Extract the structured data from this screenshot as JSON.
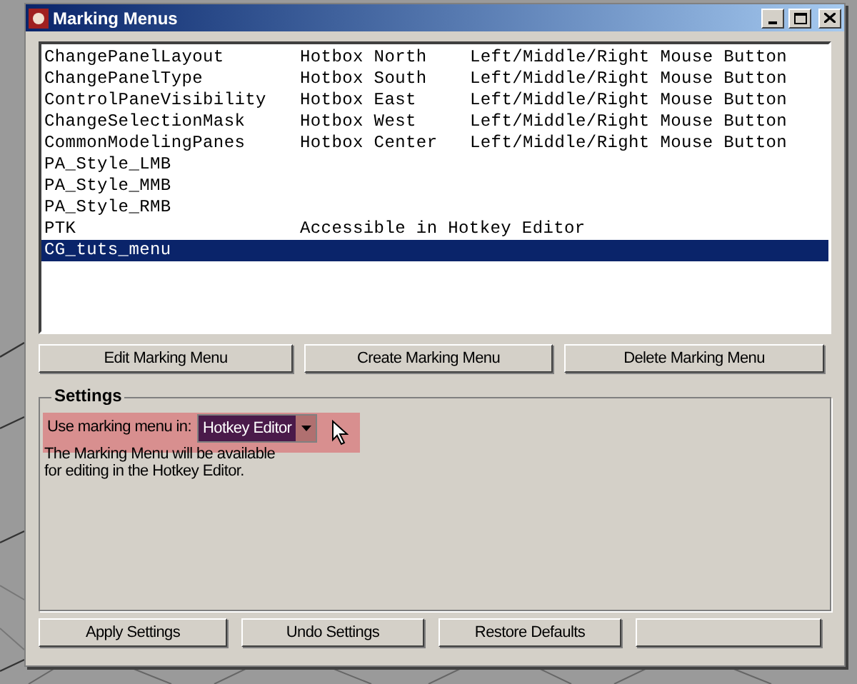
{
  "window": {
    "title": "Marking Menus"
  },
  "menus": [
    {
      "name": "ChangePanelLayout",
      "location": "Hotbox North",
      "trigger": "Left/Middle/Right Mouse Button",
      "selected": false
    },
    {
      "name": "ChangePanelType",
      "location": "Hotbox South",
      "trigger": "Left/Middle/Right Mouse Button",
      "selected": false
    },
    {
      "name": "ControlPaneVisibility",
      "location": "Hotbox East",
      "trigger": "Left/Middle/Right Mouse Button",
      "selected": false
    },
    {
      "name": "ChangeSelectionMask",
      "location": "Hotbox West",
      "trigger": "Left/Middle/Right Mouse Button",
      "selected": false
    },
    {
      "name": "CommonModelingPanes",
      "location": "Hotbox Center",
      "trigger": "Left/Middle/Right Mouse Button",
      "selected": false
    },
    {
      "name": "PA_Style_LMB",
      "selected": false
    },
    {
      "name": "PA_Style_MMB",
      "selected": false
    },
    {
      "name": "PA_Style_RMB",
      "selected": false
    },
    {
      "name": "PTK",
      "location": "Accessible in Hotkey Editor",
      "selected": false
    },
    {
      "name": "CG_tuts_menu",
      "selected": true
    }
  ],
  "menu_buttons": [
    "Edit Marking Menu",
    "Create Marking Menu",
    "Delete Marking Menu"
  ],
  "settings": {
    "title": "Settings",
    "use_label": "Use marking menu in:",
    "use_value": "Hotkey Editor",
    "highlighted": true,
    "description": [
      "The Marking Menu will be available",
      "for editing in the Hotkey Editor."
    ]
  },
  "bottom_buttons": [
    {
      "kind": "button",
      "label": "Apply Settings"
    },
    {
      "kind": "button",
      "label": "Undo Settings"
    },
    {
      "kind": "button",
      "label": "Restore Defaults"
    },
    {
      "kind": "button"
    }
  ]
}
